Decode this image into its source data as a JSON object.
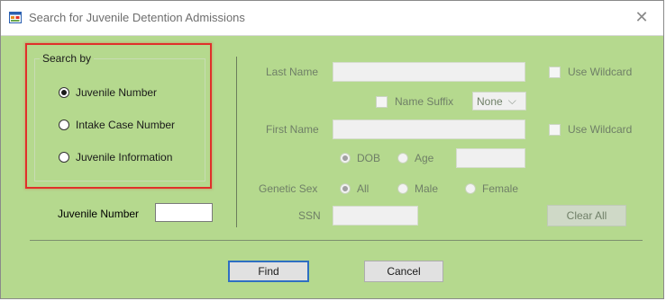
{
  "window": {
    "title": "Search for Juvenile Detention Admissions"
  },
  "search_by": {
    "label": "Search by",
    "options": [
      {
        "label": "Juvenile Number",
        "selected": true
      },
      {
        "label": "Intake Case Number",
        "selected": false
      },
      {
        "label": "Juvenile Information",
        "selected": false
      }
    ]
  },
  "juvenile_number": {
    "label": "Juvenile Number",
    "value": ""
  },
  "form": {
    "last_name": {
      "label": "Last Name",
      "value": ""
    },
    "use_wildcard_1": "Use Wildcard",
    "name_suffix": {
      "label": "Name Suffix",
      "value": "None"
    },
    "first_name": {
      "label": "First Name",
      "value": ""
    },
    "use_wildcard_2": "Use Wildcard",
    "dob_label": "DOB",
    "age_label": "Age",
    "age_value": "",
    "genetic_sex": {
      "label": "Genetic Sex",
      "options": [
        {
          "label": "All",
          "selected": true
        },
        {
          "label": "Male",
          "selected": false
        },
        {
          "label": "Female",
          "selected": false
        }
      ]
    },
    "ssn": {
      "label": "SSN",
      "value": ""
    },
    "clear_all": "Clear All"
  },
  "buttons": {
    "find": "Find",
    "cancel": "Cancel"
  },
  "colors": {
    "background": "#b5d98e",
    "highlight": "#e0302a",
    "accent": "#2f6fc2"
  }
}
